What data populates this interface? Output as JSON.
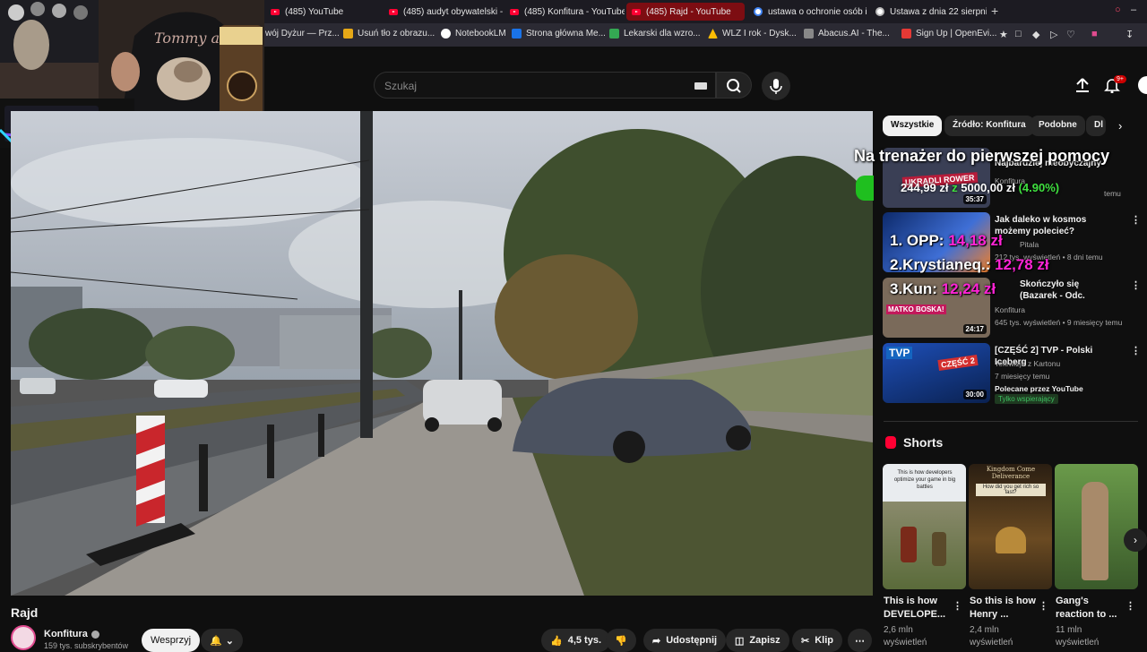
{
  "browser": {
    "tabs": [
      {
        "label": "(485) YouTube",
        "icon": "youtube-icon",
        "active": false
      },
      {
        "label": "(485) audyt obywatelski -",
        "icon": "youtube-icon",
        "active": false
      },
      {
        "label": "(485) Konfitura - YouTube",
        "icon": "youtube-icon",
        "active": false
      },
      {
        "label": "(485) Rajd - YouTube",
        "icon": "youtube-icon",
        "active": true
      },
      {
        "label": "ustawa o ochronie osób i",
        "icon": "google-icon",
        "active": false
      },
      {
        "label": "Ustawa z dnia 22 sierpnia",
        "icon": "page-icon",
        "active": false
      }
    ],
    "new_tab": "+",
    "bookmarks": [
      {
        "label": "wój Dyżur — Prz...",
        "color": "#3b6bd6"
      },
      {
        "label": "Usuń tło z obrazu...",
        "color": "#e6a817"
      },
      {
        "label": "NotebookLM",
        "color": "#ffffff"
      },
      {
        "label": "Strona główna Me...",
        "color": "#1a73e8"
      },
      {
        "label": "Lekarski dla wzro...",
        "color": "#34a853"
      },
      {
        "label": "WLZ I rok - Dysk...",
        "color": "#fbbc04"
      },
      {
        "label": "Abacus.AI - The...",
        "color": "#888888"
      },
      {
        "label": "Sign Up | OpenEvi...",
        "color": "#e53935"
      }
    ]
  },
  "youtube": {
    "search_placeholder": "Szukaj",
    "notification_count": "9+"
  },
  "overlay": {
    "goal_title": "Na trenażer do pierwszej pomocy",
    "goal_current": "244,99 zł",
    "goal_sep": "z",
    "goal_target": "5000,00 zł",
    "goal_pct": "(4.90%)",
    "ranking": [
      {
        "label": "1. OPP:",
        "amount": "14,18 zł"
      },
      {
        "label": "2.Krystianeq.:",
        "amount": "12,78 zł"
      },
      {
        "label": "3.Kun:",
        "amount": "12,24 zł"
      }
    ]
  },
  "video": {
    "title": "Rajd",
    "channel": "Konfitura",
    "subs": "159 tys. subskrybentów",
    "actions": {
      "support": "Wesprzyj",
      "likes": "4,5 tys.",
      "share": "Udostępnij",
      "save": "Zapisz",
      "clip": "Klip",
      "more": "⋯"
    }
  },
  "sidebar": {
    "chips": [
      "Wszystkie",
      "Źródło: Konfitura",
      "Podobne",
      "Dl"
    ],
    "recommendations": [
      {
        "title": "Najbardziej nieobyczajny",
        "channel": "Konfitura",
        "meta": "",
        "meta2": "temu",
        "duration": "35:37",
        "thumb_text": "UKRADLI ROWER",
        "thumb_color": "#3a3f55"
      },
      {
        "title": "Jak daleko w kosmos możemy polecieć?",
        "channel": "Pitala",
        "meta": "212 tys. wyświetleń • 8 dni temu",
        "duration": "",
        "thumb_color": "#1b3d8f"
      },
      {
        "title": "Skończyło się (Bazarek - Odc.",
        "channel": "Konfitura",
        "meta": "645 tys. wyświetleń • 9 miesięcy temu",
        "duration": "24:17",
        "thumb_text": "MATKO BOSKA!",
        "thumb_color": "#7a6a5a"
      },
      {
        "title": "[CZĘŚĆ 2] TVP - Polski Iceberg",
        "channel": "Telewizja z Kartonu",
        "meta": "7 miesięcy temu",
        "duration": "30:00",
        "thumb_text": "CZĘŚĆ 2",
        "thumb_color": "#2a4fa0",
        "recommended": "Polecane przez YouTube",
        "badge": "Tylko wspierający"
      }
    ],
    "shorts_title": "Shorts",
    "shorts": [
      {
        "title": "This is how DEVELOPE...",
        "views": "2,6 mln",
        "views2": "wyświetleń",
        "caption": "This is how developers optimize your game in big battles"
      },
      {
        "title": "So this is how Henry ...",
        "views": "2,4 mln",
        "views2": "wyświetleń",
        "caption": "How did you get rich so fast?",
        "logo": "Kingdom Come Deliverance"
      },
      {
        "title": "Gang's reaction to ...",
        "views": "11 mln",
        "views2": "wyświetleń",
        "caption": ""
      }
    ]
  }
}
